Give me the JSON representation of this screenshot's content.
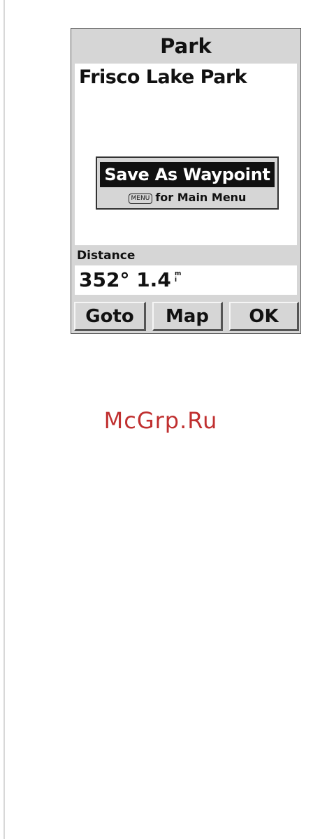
{
  "screen": {
    "title": "Park",
    "place_name": "Frisco Lake Park"
  },
  "popup": {
    "highlight_label": "Save As Waypoint",
    "menu_key": "MENU",
    "hint": "for Main Menu"
  },
  "distance": {
    "label": "Distance",
    "value": "352°  1.4",
    "unit": "mi"
  },
  "buttons": {
    "goto": "Goto",
    "map": "Map",
    "ok": "OK"
  },
  "watermark": "McGrp.Ru"
}
